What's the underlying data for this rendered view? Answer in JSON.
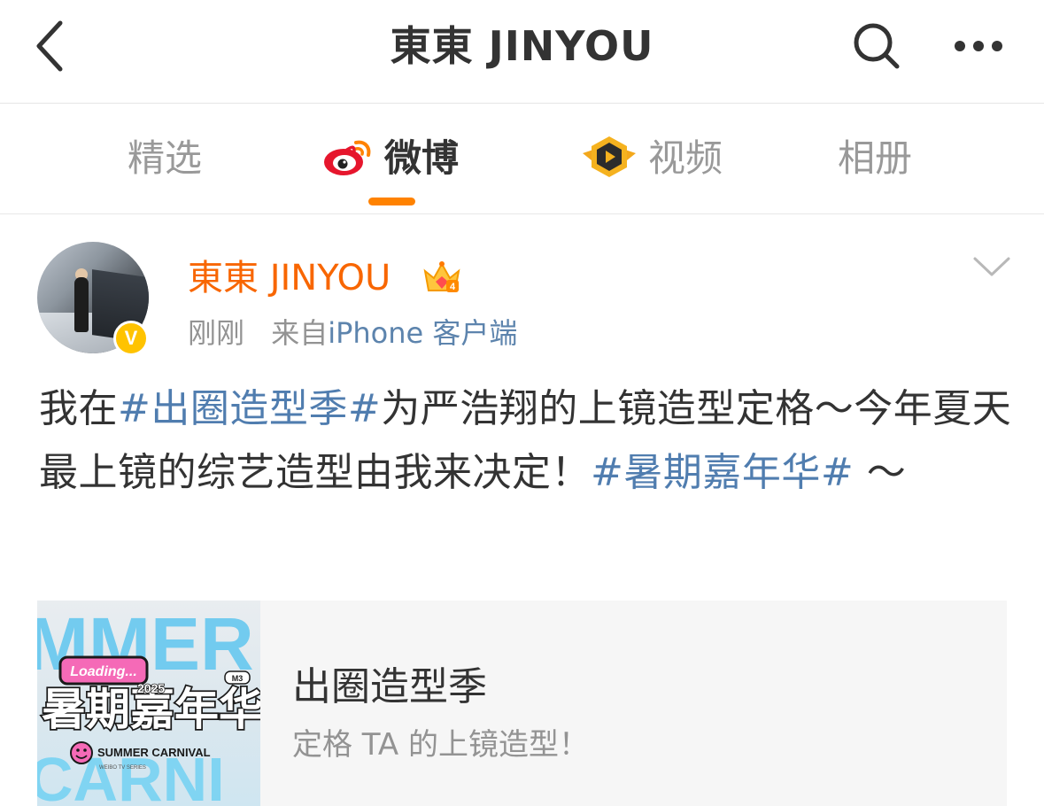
{
  "navbar": {
    "title": "東東 JINYOU"
  },
  "tabs": [
    {
      "label": "精选",
      "icon": "none"
    },
    {
      "label": "微博",
      "icon": "weibo-logo-icon",
      "active": true
    },
    {
      "label": "视频",
      "icon": "video-badge-icon"
    },
    {
      "label": "相册",
      "icon": "none"
    }
  ],
  "post": {
    "author": "東東 JINYOU",
    "verified_mark": "V",
    "crown_level": "4",
    "time": "刚刚",
    "source_prefix": "来自",
    "source": "iPhone 客户端",
    "text": {
      "t1": "我在",
      "h1": "#出圈造型季#",
      "t2": "为严浩翔的上镜造型定格～今年夏天最上镜的综艺造型由我来决定！",
      "h2": "#暑期嘉年华#",
      "t3": " ～"
    },
    "card": {
      "title": "出圈造型季",
      "subtitle": "定格 TA 的上镜造型！",
      "thumb": {
        "badge": "Loading...",
        "main": "暑期嘉年华",
        "year": "2025",
        "tag": "M3",
        "caption": "SUMMER CARNIVAL",
        "small": "WEIBO TV SERIES",
        "bg_text_top": "MMER",
        "bg_text_bottom": "CARNI"
      }
    }
  },
  "colors": {
    "accent": "#ff8200",
    "author": "#f86601",
    "link": "#507daf",
    "source": "#5d84ad",
    "verified": "#ffc300"
  }
}
